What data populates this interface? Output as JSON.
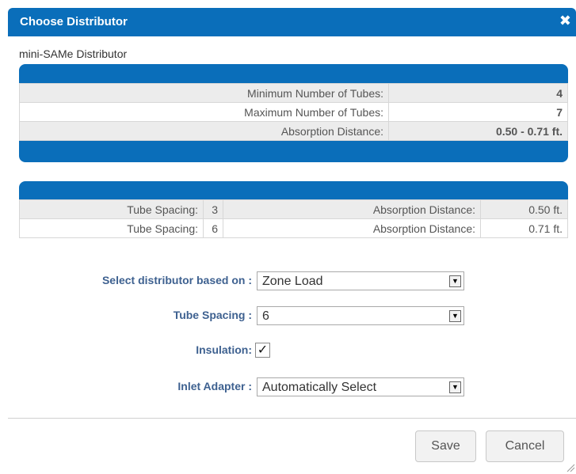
{
  "dialog": {
    "title": "Choose Distributor",
    "close_glyph": "✖",
    "subtitle": "mini-SAMe Distributor"
  },
  "summary_table": {
    "rows": [
      {
        "label": "Minimum Number of Tubes:",
        "value": "4"
      },
      {
        "label": "Maximum Number of Tubes:",
        "value": "7"
      },
      {
        "label": "Absorption Distance:",
        "value": "0.50 - 0.71 ft."
      }
    ]
  },
  "spacing_table": {
    "rows": [
      {
        "spacing_label": "Tube Spacing:",
        "spacing_value": "3",
        "distance_label": "Absorption Distance:",
        "distance_value": "0.50 ft."
      },
      {
        "spacing_label": "Tube Spacing:",
        "spacing_value": "6",
        "distance_label": "Absorption Distance:",
        "distance_value": "0.71 ft."
      }
    ]
  },
  "form": {
    "select_based_on": {
      "label": "Select distributor based on :",
      "value": "Zone Load"
    },
    "tube_spacing": {
      "label": "Tube Spacing :",
      "value": "6"
    },
    "insulation": {
      "label": "Insulation:",
      "checked": true,
      "check_glyph": "✓"
    },
    "inlet_adapter": {
      "label": "Inlet Adapter :",
      "value": "Automatically Select"
    },
    "arrow_glyph": "▼"
  },
  "buttons": {
    "save": "Save",
    "cancel": "Cancel"
  },
  "colors": {
    "accent": "#0a6eba",
    "label": "#3e6190"
  }
}
